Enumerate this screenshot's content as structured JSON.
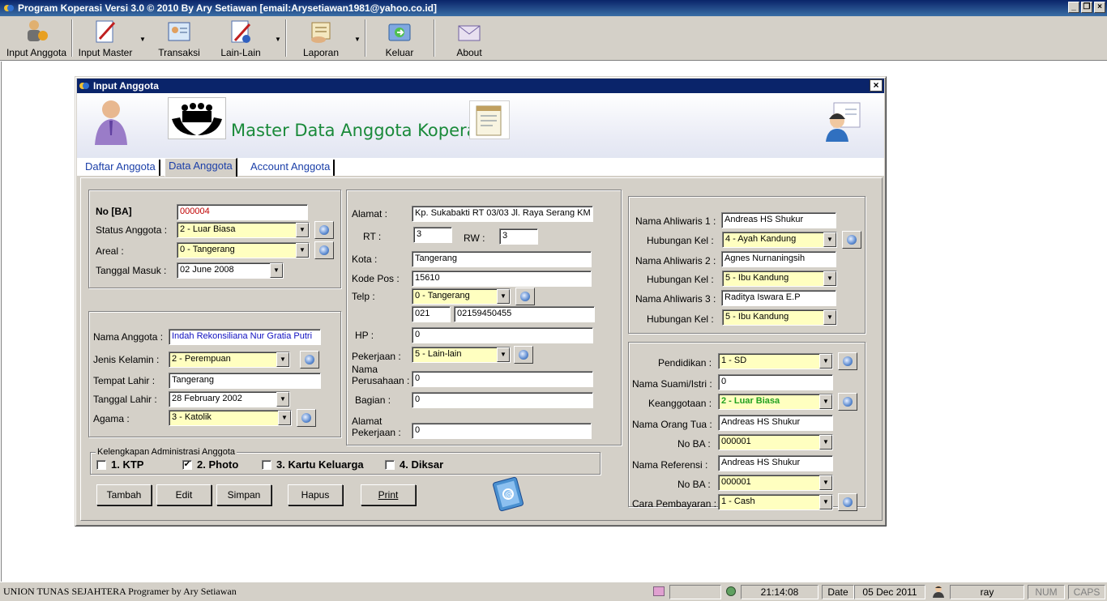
{
  "app": {
    "title": "Program Koperasi Versi 3.0  © 2010 By Ary Setiawan  [email:Arysetiawan1981@yahoo.co.id]",
    "window_buttons": [
      "_",
      "❐",
      "×"
    ]
  },
  "toolbar": {
    "items": [
      {
        "label": "Input Anggota",
        "icon": "members-icon"
      },
      {
        "label": "Input Master",
        "icon": "pencil-doc-icon"
      },
      {
        "label": "Transaksi",
        "icon": "id-card-icon"
      },
      {
        "label": "Lain-Lain",
        "icon": "doc-edit-icon"
      },
      {
        "label": "Laporan",
        "icon": "report-hand-icon"
      },
      {
        "label": "Keluar",
        "icon": "exit-folder-icon"
      },
      {
        "label": "About",
        "icon": "envelope-icon"
      }
    ],
    "dropdown_arrow": "▼"
  },
  "dialog": {
    "title": "Input Anggota",
    "close_label": "×",
    "banner_title": "Master Data Anggota Koperasi",
    "tabs": [
      "Daftar Anggota",
      "Data Anggota",
      "Account Anggota"
    ],
    "left_top": {
      "no_ba_label": "No [BA]",
      "no_ba_value": "000004",
      "status_label": "Status Anggota :",
      "status_value": "2 - Luar Biasa",
      "areal_label": "Areal :",
      "areal_value": "0 - Tangerang",
      "tgl_masuk_label": "Tanggal Masuk :",
      "tgl_masuk_value": "02     June     2008"
    },
    "left_bottom": {
      "nama_label": "Nama Anggota :",
      "nama_value": "Indah Rekonsiliana Nur Gratia Putri",
      "jk_label": "Jenis Kelamin :",
      "jk_value": "2 - Perempuan",
      "tempat_label": "Tempat Lahir :",
      "tempat_value": "Tangerang",
      "tgl_lahir_label": "Tanggal Lahir :",
      "tgl_lahir_value": "28  February  2002",
      "agama_label": "Agama :",
      "agama_value": "3 - Katolik"
    },
    "middle": {
      "alamat_label": "Alamat :",
      "alamat_value": "Kp. Sukabakti RT 03/03 Jl. Raya Serang KM",
      "rt_label": "RT :",
      "rt_value": "3",
      "rw_label": "RW :",
      "rw_value": "3",
      "kota_label": "Kota :",
      "kota_value": "Tangerang",
      "kodepos_label": "Kode Pos :",
      "kodepos_value": "15610",
      "telp_label": "Telp :",
      "telp_area": "0 - Tangerang",
      "telp_code": "021",
      "telp_number": "02159450455",
      "hp_label": "HP :",
      "hp_value": "0",
      "pekerjaan_label": "Pekerjaan :",
      "pekerjaan_value": "5 - Lain-lain",
      "perusahaan_label_1": "Nama",
      "perusahaan_label_2": "Perusahaan :",
      "perusahaan_value": "0",
      "bagian_label": "Bagian :",
      "bagian_value": "0",
      "alamat_kerja_label_1": "Alamat",
      "alamat_kerja_label_2": "Pekerjaan :",
      "alamat_kerja_value": "0"
    },
    "right_top": {
      "ahli1_label": "Nama Ahliwaris 1 :",
      "ahli1_value": "Andreas HS Shukur",
      "hub1_label": "Hubungan Kel :",
      "hub1_value": "4 - Ayah Kandung",
      "ahli2_label": "Nama Ahliwaris 2 :",
      "ahli2_value": "Agnes Nurnaningsih",
      "hub2_label": "Hubungan Kel :",
      "hub2_value": "5 - Ibu Kandung",
      "ahli3_label": "Nama Ahliwaris 3 :",
      "ahli3_value": "Raditya Iswara E.P",
      "hub3_label": "Hubungan Kel :",
      "hub3_value": "5 - Ibu Kandung"
    },
    "right_bottom": {
      "pendidikan_label": "Pendidikan :",
      "pendidikan_value": "1 - SD",
      "suami_label": "Nama Suami/Istri :",
      "suami_value": "0",
      "keanggotaan_label": "Keanggotaan :",
      "keanggotaan_value": "2 - Luar Biasa",
      "orangtua_label": "Nama Orang Tua :",
      "orangtua_value": "Andreas HS Shukur",
      "noba1_label": "No BA :",
      "noba1_value": "000001",
      "referensi_label": "Nama Referensi :",
      "referensi_value": "Andreas HS Shukur",
      "noba2_label": "No BA :",
      "noba2_value": "000001",
      "bayar_label": "Cara Pembayaran :",
      "bayar_value": "1 - Cash"
    },
    "kelengkapan": {
      "legend": "Kelengkapan Administrasi Anggota",
      "items": [
        {
          "label": "1. KTP",
          "checked": false
        },
        {
          "label": "2. Photo",
          "checked": true
        },
        {
          "label": "3. Kartu Keluarga",
          "checked": false
        },
        {
          "label": "4. Diksar",
          "checked": false
        }
      ],
      "check_mark": "✔"
    },
    "buttons": [
      "Tambah",
      "Edit",
      "Simpan",
      "Hapus",
      "Print"
    ]
  },
  "statusbar": {
    "company": "UNION TUNAS SEJAHTERA Programer by Ary Setiawan",
    "time": "21:14:08",
    "date_label": "Date",
    "date_value": "05 Dec 2011",
    "user": "ray",
    "num": "NUM",
    "caps": "CAPS"
  },
  "colors": {
    "titlebar": "#0a246a",
    "banner_title": "#1a8a3a",
    "tab_text": "#1b3fa8",
    "combo_yellow": "#ffffc0",
    "no_ba_red": "#c00000",
    "name_blue": "#1010c0",
    "keanggotaan_green": "#20a020"
  }
}
